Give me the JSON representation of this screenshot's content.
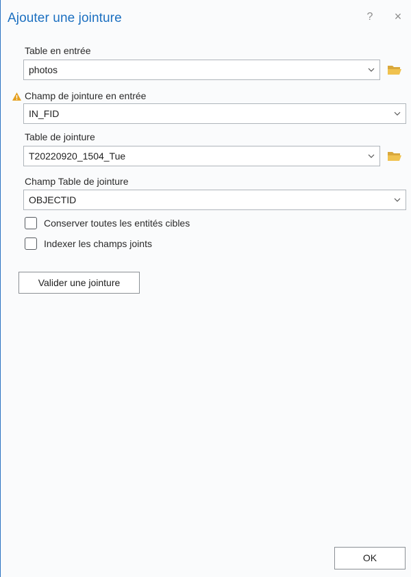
{
  "dialog": {
    "title": "Ajouter une jointure",
    "help_label": "?",
    "close_label": "×"
  },
  "fields": {
    "input_table": {
      "label": "Table en entrée",
      "value": "photos"
    },
    "input_join_field": {
      "label": "Champ de jointure en entrée",
      "value": "IN_FID",
      "warning": true
    },
    "join_table": {
      "label": "Table de jointure",
      "value": "T20220920_1504_Tue"
    },
    "join_table_field": {
      "label": "Champ Table de jointure",
      "value": "OBJECTID"
    }
  },
  "options": {
    "keep_all": {
      "label": "Conserver toutes les entités cibles",
      "checked": false
    },
    "index_fields": {
      "label": "Indexer les champs joints",
      "checked": false
    }
  },
  "buttons": {
    "validate_label": "Valider une jointure",
    "ok_label": "OK"
  },
  "colors": {
    "title": "#1b6fc0",
    "accent_border": "#2b73c2",
    "folder": "#e8b94a",
    "warning": "#e5a020"
  },
  "icons": {
    "folder": "folder-open-icon",
    "warning": "warning-icon",
    "dropdown": "chevron-down-icon"
  }
}
